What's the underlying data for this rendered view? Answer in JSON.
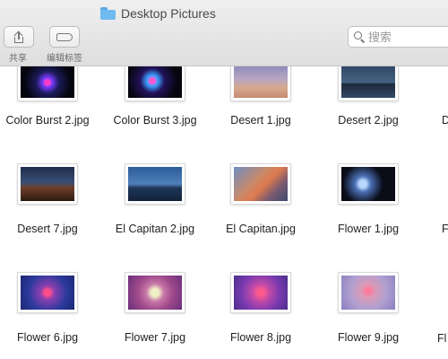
{
  "window": {
    "title": "Desktop Pictures"
  },
  "toolbar": {
    "share_label": "共享",
    "tags_label": "编辑标签",
    "search_placeholder": "搜索"
  },
  "files": {
    "row1": [
      "Color Burst 2.jpg",
      "Color Burst 3.jpg",
      "Desert 1.jpg",
      "Desert 2.jpg"
    ],
    "row2": [
      "Desert 7.jpg",
      "El Capitan 2.jpg",
      "El Capitan.jpg",
      "Flower 1.jpg"
    ],
    "row3": [
      "Flower 6.jpg",
      "Flower 7.jpg",
      "Flower 8.jpg",
      "Flower 9.jpg"
    ],
    "row1_partial": "D",
    "row2_partial": "F",
    "row3_partial": "Fl"
  }
}
